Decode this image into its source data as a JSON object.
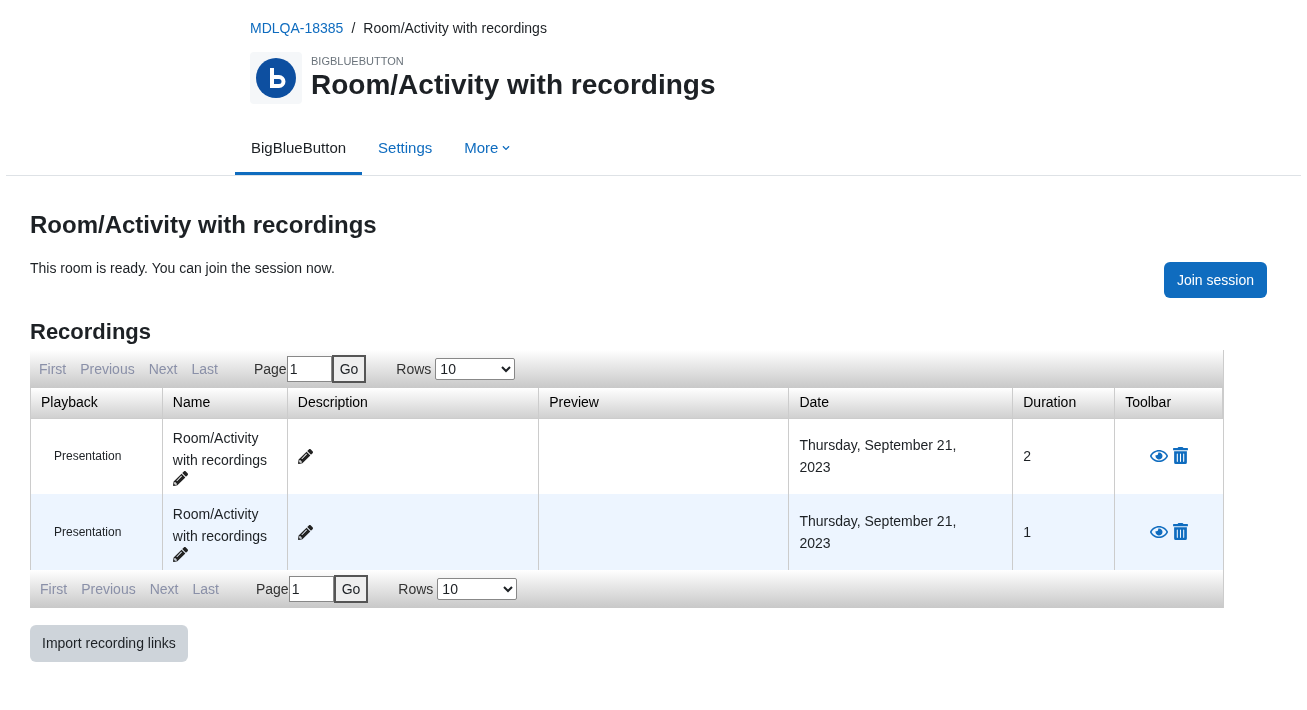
{
  "breadcrumb": [
    {
      "label": "MDLQA-18385",
      "link": true
    },
    {
      "label": "/",
      "link": false
    },
    {
      "label": "Room/Activity with recordings",
      "link": false
    }
  ],
  "header": {
    "module": "BIGBLUEBUTTON",
    "title": "Room/Activity with recordings"
  },
  "tabs": [
    {
      "label": "BigBlueButton",
      "selected": true,
      "dropdown": false
    },
    {
      "label": "Settings",
      "selected": false,
      "dropdown": false
    },
    {
      "label": "More",
      "selected": false,
      "dropdown": true
    }
  ],
  "page_title": "Room/Activity with recordings",
  "status_message": "This room is ready. You can join the session now.",
  "join_button": "Join session",
  "recordings": {
    "title": "Recordings",
    "paginator_top": {
      "links": [
        {
          "label": "First",
          "disabled": true
        },
        {
          "label": "Previous",
          "disabled": true
        },
        {
          "label": "Next",
          "disabled": true
        },
        {
          "label": "Last",
          "disabled": true
        }
      ],
      "page_label": "Page",
      "page_value": "1",
      "go": "Go",
      "rows_label": "Rows",
      "rows_value": "10"
    },
    "columns": [
      "Playback",
      "Name",
      "Description",
      "Preview",
      "Date",
      "Duration",
      "Toolbar"
    ],
    "rows": [
      {
        "playback": "Presentation",
        "name": "Room/Activity with recordings",
        "date": "Thursday, September 21, 2023",
        "duration": "2"
      },
      {
        "playback": "Presentation",
        "name": "Room/Activity with recordings",
        "date": "Thursday, September 21, 2023",
        "duration": "1"
      }
    ],
    "paginator_bottom": {
      "links": [
        {
          "label": "First",
          "disabled": true
        },
        {
          "label": "Previous",
          "disabled": true
        },
        {
          "label": "Next",
          "disabled": true
        },
        {
          "label": "Last",
          "disabled": true
        }
      ],
      "page_label": "Page",
      "page_value": "1",
      "go": "Go",
      "rows_label": "Rows",
      "rows_value": "10"
    }
  },
  "import_button": "Import recording links"
}
